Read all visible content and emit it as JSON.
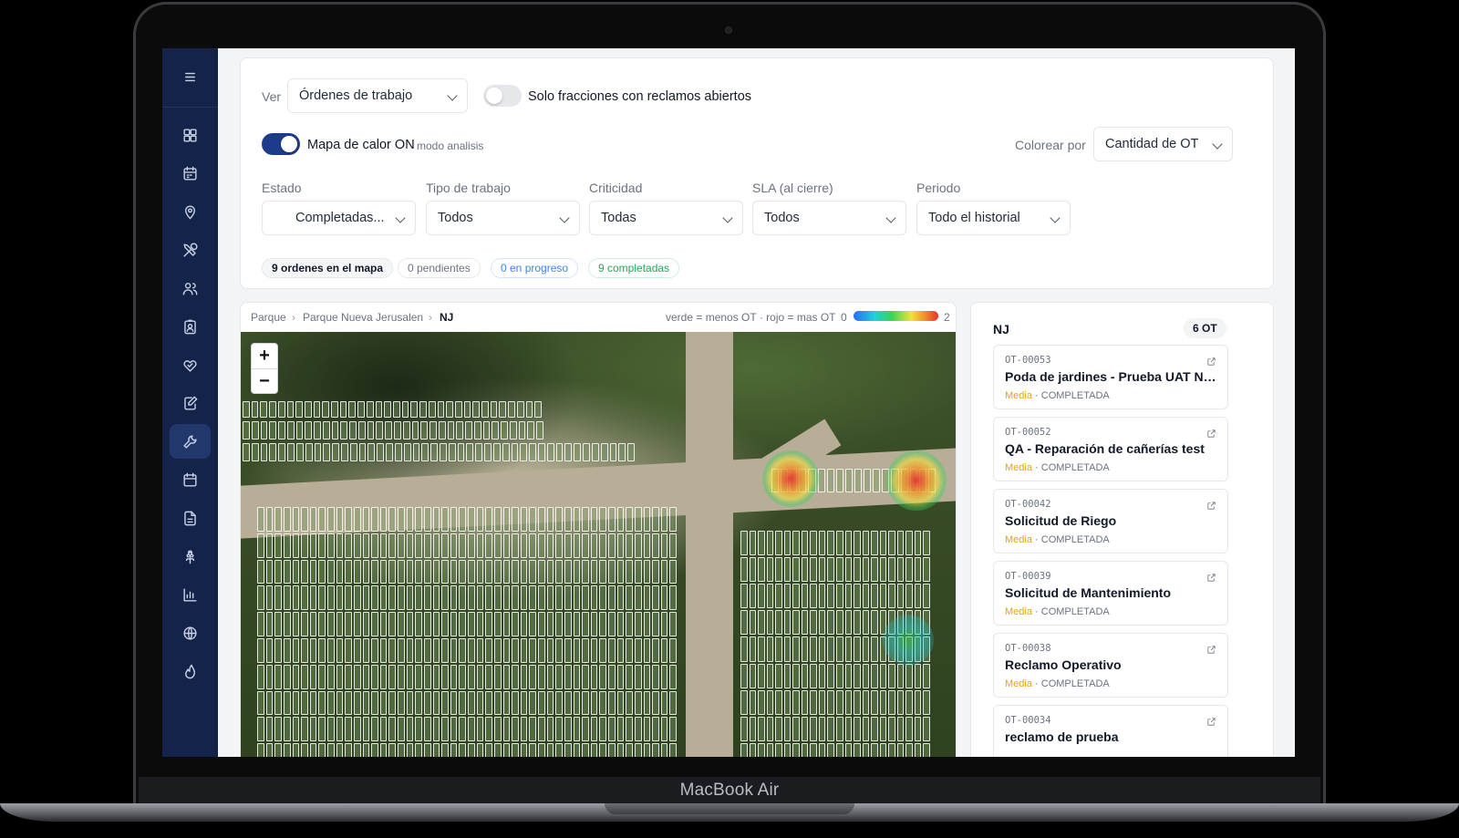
{
  "device": {
    "model_label": "MacBook Air"
  },
  "sidebar": {
    "items": [
      {
        "icon": "dashboard-icon"
      },
      {
        "icon": "calendar-icon"
      },
      {
        "icon": "map-pin-icon"
      },
      {
        "icon": "tools-icon"
      },
      {
        "icon": "users-icon"
      },
      {
        "icon": "contact-card-icon"
      },
      {
        "icon": "handshake-heart-icon"
      },
      {
        "icon": "edit-document-icon"
      },
      {
        "icon": "wrench-icon",
        "active": true
      },
      {
        "icon": "calendar-alt-icon"
      },
      {
        "icon": "document-icon"
      },
      {
        "icon": "flower-icon"
      },
      {
        "icon": "bar-chart-icon"
      },
      {
        "icon": "globe-icon"
      },
      {
        "icon": "flame-icon"
      }
    ]
  },
  "filters": {
    "view_label": "Ver",
    "view_value": "Órdenes de trabajo",
    "open_claims_toggle_label": "Solo fracciones con reclamos abiertos",
    "heatmap_toggle_label": "Mapa de calor ON",
    "heatmap_mode": "modo analisis",
    "color_by_label": "Colorear por",
    "color_by_value": "Cantidad de OT",
    "estado_label": "Estado",
    "estado_value": "Completadas...",
    "tipo_label": "Tipo de trabajo",
    "tipo_value": "Todos",
    "criticidad_label": "Criticidad",
    "criticidad_value": "Todas",
    "sla_label": "SLA (al cierre)",
    "sla_value": "Todos",
    "periodo_label": "Periodo",
    "periodo_value": "Todo el historial",
    "summary": {
      "total": "9 ordenes en el mapa",
      "pendientes": "0 pendientes",
      "en_progreso": "0 en progreso",
      "completadas": "9 completadas"
    },
    "colors": {
      "in_progress": "#3b82f6",
      "completed": "#22a85a",
      "toggle_on": "#1e3a8a"
    }
  },
  "map": {
    "breadcrumb": [
      "Parque",
      "Parque Nueva Jerusalen",
      "NJ"
    ],
    "legend_text": "verde = menos OT · rojo = mas OT",
    "legend_min": "0",
    "legend_max": "2",
    "zoom_in": "+",
    "zoom_out": "−"
  },
  "ot_panel": {
    "title": "NJ",
    "count": "6 OT",
    "orders": [
      {
        "code": "OT-00053",
        "name": "Poda de jardines - Prueba UAT NJ-...",
        "priority": "Media",
        "status": "COMPLETADA"
      },
      {
        "code": "OT-00052",
        "name": "QA - Reparación de cañerías test",
        "priority": "Media",
        "status": "COMPLETADA"
      },
      {
        "code": "OT-00042",
        "name": "Solicitud de Riego",
        "priority": "Media",
        "status": "COMPLETADA"
      },
      {
        "code": "OT-00039",
        "name": "Solicitud de Mantenimiento",
        "priority": "Media",
        "status": "COMPLETADA"
      },
      {
        "code": "OT-00038",
        "name": "Reclamo Operativo",
        "priority": "Media",
        "status": "COMPLETADA"
      },
      {
        "code": "OT-00034",
        "name": "reclamo de prueba",
        "priority": "",
        "status": ""
      }
    ],
    "separator": "·"
  }
}
